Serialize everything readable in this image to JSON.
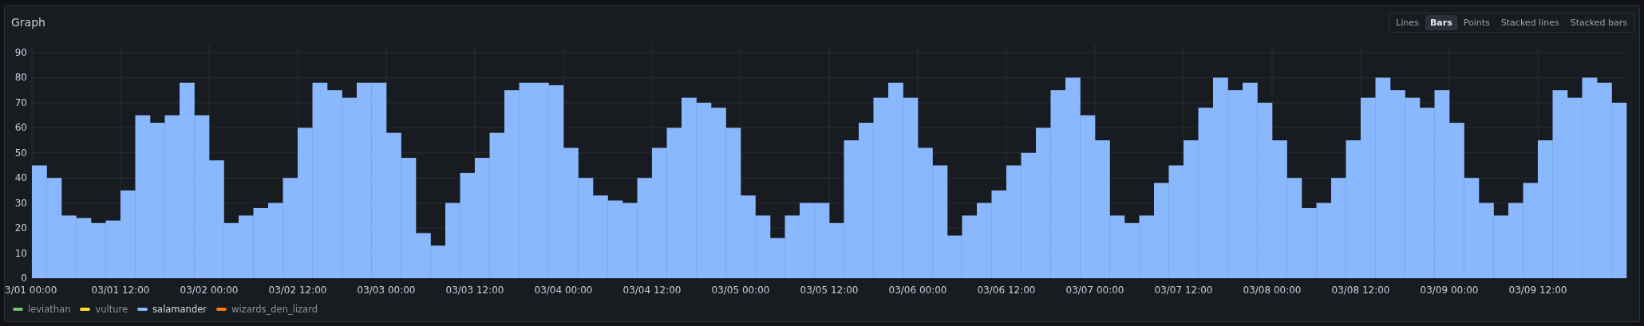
{
  "panel": {
    "title": "Graph"
  },
  "modes": [
    {
      "label": "Lines",
      "selected": false
    },
    {
      "label": "Bars",
      "selected": true
    },
    {
      "label": "Points",
      "selected": false
    },
    {
      "label": "Stacked lines",
      "selected": false
    },
    {
      "label": "Stacked bars",
      "selected": false
    }
  ],
  "chart_data": {
    "type": "bar",
    "grid": true,
    "ylim": [
      0,
      90
    ],
    "yticks": [
      0,
      10,
      20,
      30,
      40,
      50,
      60,
      70,
      80,
      90
    ],
    "categories": [
      "3/01 00:00",
      null,
      null,
      null,
      null,
      null,
      "03/01 12:00",
      null,
      null,
      null,
      null,
      null,
      "03/02 00:00",
      null,
      null,
      null,
      null,
      null,
      "03/02 12:00",
      null,
      null,
      null,
      null,
      null,
      "03/03 00:00",
      null,
      null,
      null,
      null,
      null,
      "03/03 12:00",
      null,
      null,
      null,
      null,
      null,
      "03/04 00:00",
      null,
      null,
      null,
      null,
      null,
      "03/04 12:00",
      null,
      null,
      null,
      null,
      null,
      "03/05 00:00",
      null,
      null,
      null,
      null,
      null,
      "03/05 12:00",
      null,
      null,
      null,
      null,
      null,
      "03/06 00:00",
      null,
      null,
      null,
      null,
      null,
      "03/06 12:00",
      null,
      null,
      null,
      null,
      null,
      "03/07 00:00",
      null,
      null,
      null,
      null,
      null,
      "03/07 12:00",
      null,
      null,
      null,
      null,
      null,
      "03/08 00:00",
      null,
      null,
      null,
      null,
      null,
      "03/08 12:00",
      null,
      null,
      null,
      null,
      null,
      "03/09 00:00",
      null,
      null,
      null,
      null,
      null,
      "03/09 12:00",
      null,
      null,
      null,
      null,
      null
    ],
    "series": [
      {
        "name": "salamander",
        "color": "#8ab8ff",
        "values": [
          45,
          40,
          25,
          24,
          22,
          23,
          35,
          65,
          62,
          65,
          78,
          65,
          47,
          22,
          25,
          28,
          30,
          40,
          60,
          78,
          75,
          72,
          78,
          78,
          58,
          48,
          18,
          13,
          30,
          42,
          48,
          58,
          75,
          78,
          78,
          77,
          52,
          40,
          33,
          31,
          30,
          40,
          52,
          60,
          72,
          70,
          68,
          60,
          33,
          25,
          16,
          25,
          30,
          30,
          22,
          55,
          62,
          72,
          78,
          72,
          52,
          45,
          17,
          25,
          30,
          35,
          45,
          50,
          60,
          75,
          80,
          65,
          55,
          25,
          22,
          25,
          38,
          45,
          55,
          68,
          80,
          75,
          78,
          70,
          55,
          40,
          28,
          30,
          40,
          55,
          72,
          80,
          75,
          72,
          68,
          75,
          62,
          40,
          30,
          25,
          30,
          38,
          55,
          75,
          72,
          80,
          78,
          70
        ]
      }
    ]
  },
  "legend": [
    {
      "kind": "name",
      "name": "leviathan",
      "color": "#73bf69",
      "selected": false
    },
    {
      "kind": "name",
      "name": "vulture",
      "color": "#fade2a",
      "selected": false
    },
    {
      "kind": "series",
      "selected": true
    },
    {
      "kind": "name",
      "name": "wizards_den_lizard",
      "color": "#ff780a",
      "selected": false
    }
  ]
}
